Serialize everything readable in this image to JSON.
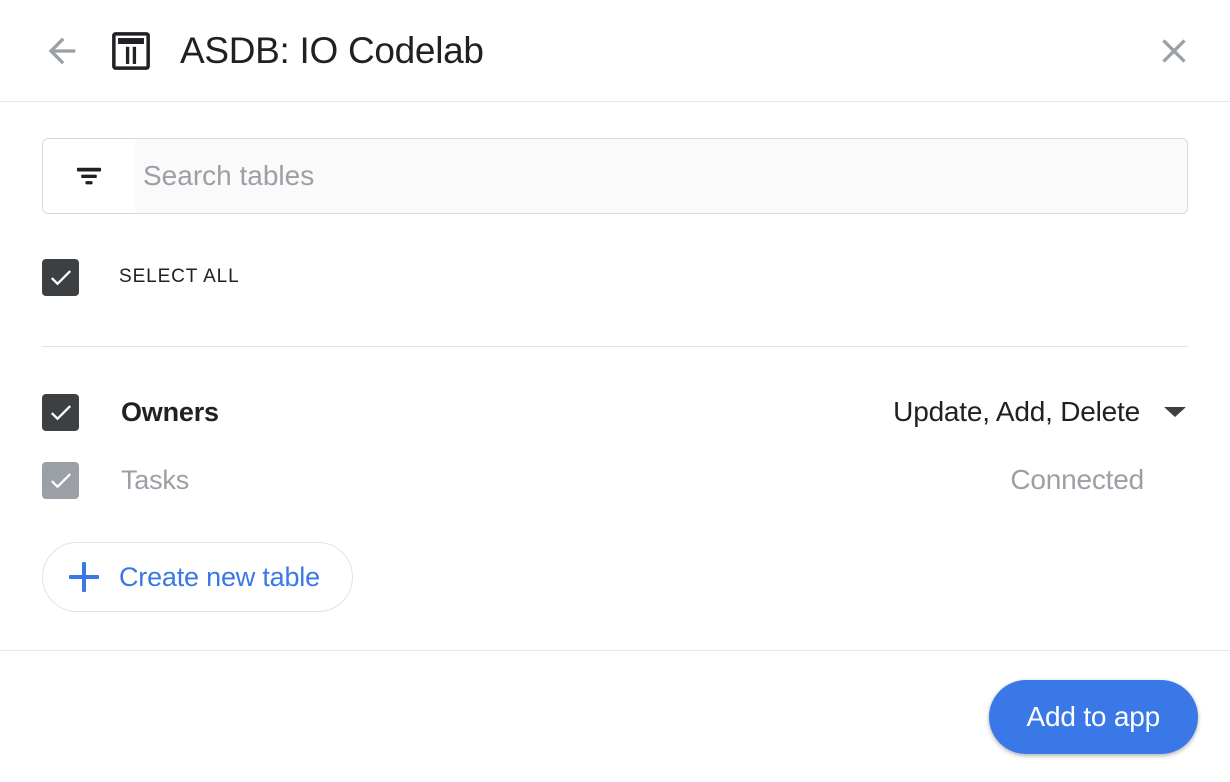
{
  "header": {
    "back_icon": "back-arrow-icon",
    "app_icon": "table-icon",
    "title": "ASDB: IO Codelab",
    "close_icon": "close-icon"
  },
  "search": {
    "icon": "filter-icon",
    "placeholder": "Search tables",
    "value": ""
  },
  "select_all": {
    "label": "SELECT ALL",
    "checked": true
  },
  "tables": [
    {
      "name": "Owners",
      "checked": true,
      "enabled": true,
      "permissions": "Update, Add, Delete",
      "caret_icon": "chevron-down-icon"
    },
    {
      "name": "Tasks",
      "checked": true,
      "enabled": false,
      "status": "Connected"
    }
  ],
  "create_table": {
    "icon": "plus-icon",
    "label": "Create new table"
  },
  "footer": {
    "primary_label": "Add to app"
  },
  "colors": {
    "accent": "#3b78e7",
    "checkbox": "#3c4043",
    "checkbox_disabled": "#9aa0a6",
    "text": "#202124",
    "muted": "#9aa0a6",
    "divider": "#e0e2e4"
  }
}
